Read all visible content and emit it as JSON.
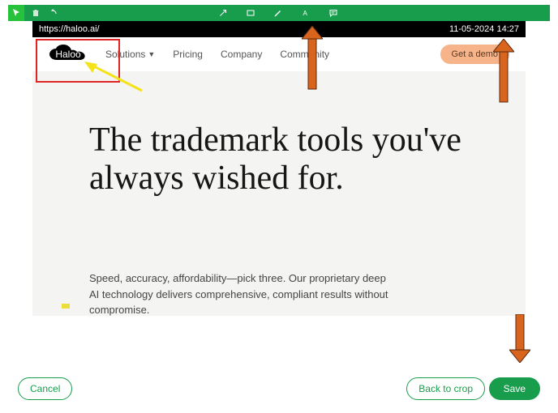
{
  "toolbar": {
    "tools": {
      "cursor": "cursor-icon",
      "delete": "trash-icon",
      "undo": "undo-icon",
      "arrow_tool": "arrow-tool-icon",
      "rect_tool": "rectangle-tool-icon",
      "pen_tool": "pen-tool-icon",
      "text_tool": "text-tool-icon",
      "comment_tool": "comment-tool-icon"
    }
  },
  "urlbar": {
    "url": "https://haloo.ai/",
    "timestamp": "11-05-2024 14:27"
  },
  "site": {
    "logo_text": "Haloo",
    "nav": {
      "solutions": "Solutions",
      "pricing": "Pricing",
      "company": "Company",
      "community": "Community"
    },
    "cta": "Get a demo",
    "hero_title": "The trademark tools you've always wished for.",
    "hero_sub": "Speed, accuracy, affordability—pick three. Our proprietary deep AI technology delivers comprehensive, compliant results without compromise."
  },
  "annotations": {
    "red_rect": "highlight-logo-area",
    "yellow_arrow": "points-to-logo",
    "orange_arrow_1": "points-to-rect-tool",
    "orange_arrow_2": "points-to-timestamp",
    "orange_arrow_3": "points-to-save-button"
  },
  "buttons": {
    "cancel": "Cancel",
    "back": "Back to crop",
    "save": "Save"
  },
  "colors": {
    "toolbar_green": "#189d4c",
    "cursor_green": "#27c13b",
    "orange": "#d9641e",
    "red": "#e02424",
    "yellow": "#f4e31a",
    "demo_peach": "#f7b48b"
  }
}
